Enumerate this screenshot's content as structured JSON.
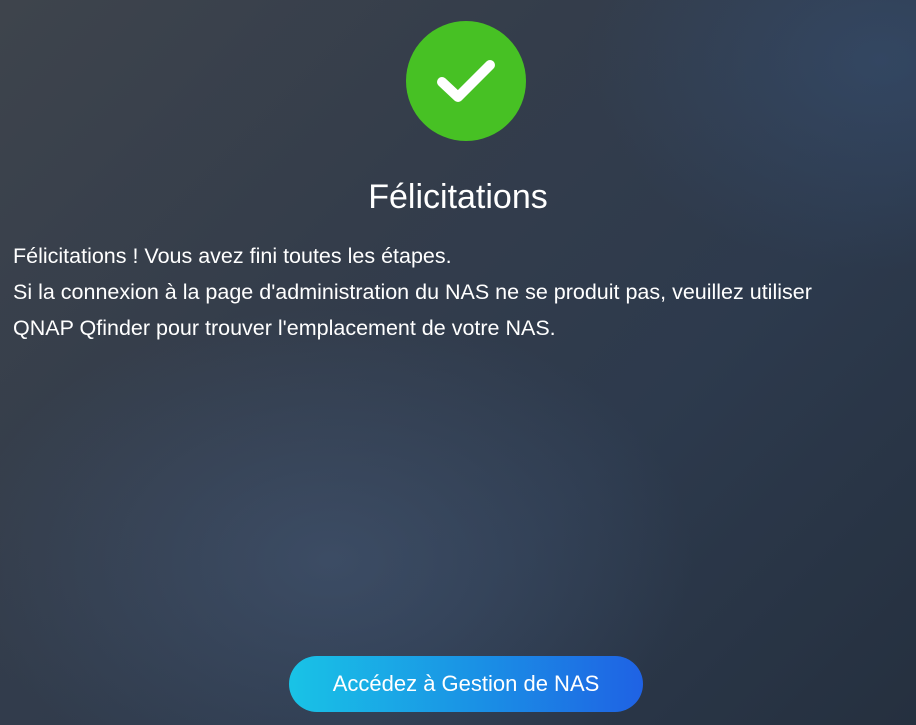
{
  "success_icon": "checkmark-icon",
  "colors": {
    "success": "#47c124",
    "button_start": "#19c3e6",
    "button_end": "#1f62e4"
  },
  "heading": "Félicitations",
  "message": {
    "line1": "Félicitations ! Vous avez fini toutes les étapes.",
    "line2": "Si la connexion à la page d'administration du NAS ne se produit pas, veuillez utiliser",
    "line3": "QNAP Qfinder pour trouver l'emplacement de votre NAS."
  },
  "button": {
    "label": "Accédez à Gestion de NAS"
  }
}
